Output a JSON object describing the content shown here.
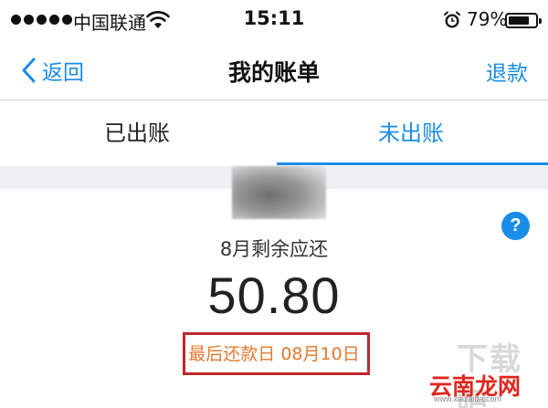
{
  "status_bar": {
    "carrier": "中国联通",
    "time": "15:11",
    "battery_percent": "79%",
    "battery_level": 0.79,
    "icons": [
      "signal-dots-icon",
      "wifi-icon",
      "alarm-icon",
      "battery-icon"
    ]
  },
  "nav": {
    "back_label": "返回",
    "title": "我的账单",
    "refund_label": "退款"
  },
  "tabs": [
    {
      "label": "已出账",
      "active": false
    },
    {
      "label": "未出账",
      "active": true
    }
  ],
  "bill": {
    "label": "8月剩余应还",
    "amount": "50.80",
    "due_text": "最后还款日 08月10日",
    "help_symbol": "?"
  },
  "watermark": {
    "top_text": "下载吧",
    "logo_text": "云南龙网",
    "url": "www.xiazaiba.com"
  },
  "colors": {
    "accent": "#1a8ce8",
    "due_text": "#e07a2f",
    "highlight_border": "#c0262d",
    "watermark_logo": "#e0261d"
  }
}
